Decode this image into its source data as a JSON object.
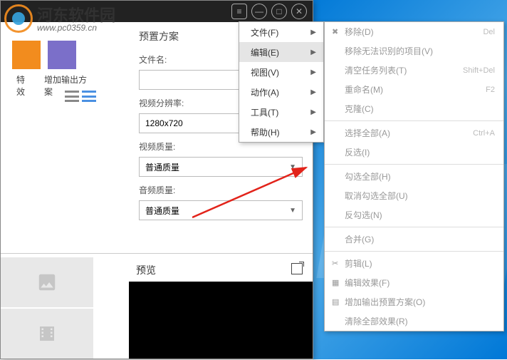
{
  "watermark": {
    "brand": "河东软件园",
    "url": "www.pc0359.cn"
  },
  "titlebar": {
    "menu": "≡",
    "min": "—",
    "max": "□",
    "close": "✕"
  },
  "tabs": {
    "effects": "特效",
    "addOutput": "增加输出方案"
  },
  "panel": {
    "presetTitle": "预置方案",
    "filenameLabel": "文件名:",
    "filenameValue": "",
    "resolutionLabel": "视频分辨率:",
    "resolutionValue": "1280x720",
    "videoQualityLabel": "视频质量:",
    "videoQualityValue": "普通质量",
    "audioQualityLabel": "音频质量:",
    "audioQualityValue": "普通质量",
    "previewLabel": "预览"
  },
  "menu1": [
    {
      "label": "文件(F)",
      "sub": true
    },
    {
      "label": "编辑(E)",
      "sub": true,
      "hover": true
    },
    {
      "label": "视图(V)",
      "sub": true
    },
    {
      "label": "动作(A)",
      "sub": true
    },
    {
      "label": "工具(T)",
      "sub": true
    },
    {
      "label": "帮助(H)",
      "sub": true
    }
  ],
  "menu2Groups": [
    [
      {
        "icon": "✖",
        "label": "移除(D)",
        "shortcut": "Del"
      },
      {
        "icon": "",
        "label": "移除无法识别的项目(V)",
        "shortcut": ""
      },
      {
        "icon": "",
        "label": "清空任务列表(T)",
        "shortcut": "Shift+Del"
      },
      {
        "icon": "",
        "label": "重命名(M)",
        "shortcut": "F2"
      },
      {
        "icon": "",
        "label": "克隆(C)",
        "shortcut": ""
      }
    ],
    [
      {
        "icon": "",
        "label": "选择全部(A)",
        "shortcut": "Ctrl+A"
      },
      {
        "icon": "",
        "label": "反选(I)",
        "shortcut": ""
      }
    ],
    [
      {
        "icon": "",
        "label": "勾选全部(H)",
        "shortcut": ""
      },
      {
        "icon": "",
        "label": "取消勾选全部(U)",
        "shortcut": ""
      },
      {
        "icon": "",
        "label": "反勾选(N)",
        "shortcut": ""
      }
    ],
    [
      {
        "icon": "",
        "label": "合并(G)",
        "shortcut": ""
      }
    ],
    [
      {
        "icon": "✂",
        "label": "剪辑(L)",
        "shortcut": ""
      },
      {
        "icon": "▦",
        "label": "编辑效果(F)",
        "shortcut": ""
      },
      {
        "icon": "▤",
        "label": "增加输出预置方案(O)",
        "shortcut": ""
      },
      {
        "icon": "",
        "label": "清除全部效果(R)",
        "shortcut": ""
      }
    ]
  ]
}
